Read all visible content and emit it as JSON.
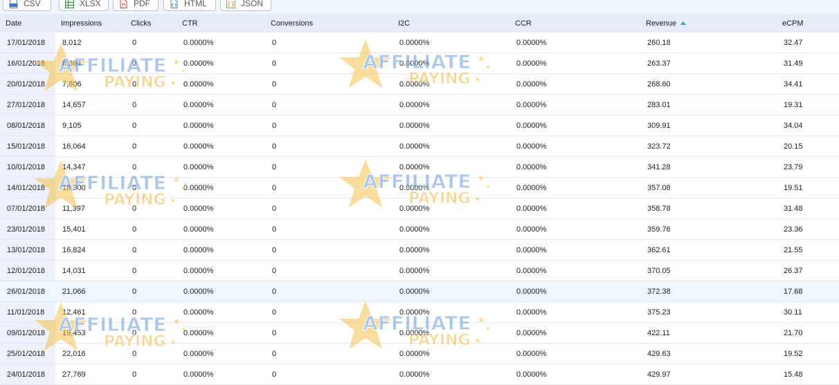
{
  "toolbar": {
    "buttons": [
      {
        "label": "CSV"
      },
      {
        "label": "XLSX"
      },
      {
        "label": "PDF"
      },
      {
        "label": "HTML"
      },
      {
        "label": "JSON"
      }
    ]
  },
  "table": {
    "headers": [
      "Date",
      "Impressions",
      "Clicks",
      "CTR",
      "Conversions",
      "I2C",
      "CCR",
      "Revenue",
      "eCPM"
    ],
    "sort": {
      "column": "Revenue",
      "direction": "ascending"
    },
    "rows": [
      [
        "17/01/2018",
        "8,012",
        "0",
        "0.0000%",
        "0",
        "0.0000%",
        "0.0000%",
        "260.18",
        "32.47"
      ],
      [
        "16/01/2018",
        "8,364",
        "0",
        "0.0000%",
        "0",
        "0.0000%",
        "0.0000%",
        "263.37",
        "31.49"
      ],
      [
        "20/01/2018",
        "7,806",
        "0",
        "0.0000%",
        "0",
        "0.0000%",
        "0.0000%",
        "268.60",
        "34.41"
      ],
      [
        "27/01/2018",
        "14,657",
        "0",
        "0.0000%",
        "0",
        "0.0000%",
        "0.0000%",
        "283.01",
        "19.31"
      ],
      [
        "08/01/2018",
        "9,105",
        "0",
        "0.0000%",
        "0",
        "0.0000%",
        "0.0000%",
        "309.91",
        "34.04"
      ],
      [
        "15/01/2018",
        "16,064",
        "0",
        "0.0000%",
        "0",
        "0.0000%",
        "0.0000%",
        "323.72",
        "20.15"
      ],
      [
        "10/01/2018",
        "14,347",
        "0",
        "0.0000%",
        "0",
        "0.0000%",
        "0.0000%",
        "341.28",
        "23.79"
      ],
      [
        "14/01/2018",
        "18,300",
        "0",
        "0.0000%",
        "0",
        "0.0000%",
        "0.0000%",
        "357.08",
        "19.51"
      ],
      [
        "07/01/2018",
        "11,397",
        "0",
        "0.0000%",
        "0",
        "0.0000%",
        "0.0000%",
        "358.78",
        "31.48"
      ],
      [
        "23/01/2018",
        "15,401",
        "0",
        "0.0000%",
        "0",
        "0.0000%",
        "0.0000%",
        "359.76",
        "23.36"
      ],
      [
        "13/01/2018",
        "16,824",
        "0",
        "0.0000%",
        "0",
        "0.0000%",
        "0.0000%",
        "362.61",
        "21.55"
      ],
      [
        "12/01/2018",
        "14,031",
        "0",
        "0.0000%",
        "0",
        "0.0000%",
        "0.0000%",
        "370.05",
        "26.37"
      ],
      [
        "26/01/2018",
        "21,066",
        "0",
        "0.0000%",
        "0",
        "0.0000%",
        "0.0000%",
        "372.38",
        "17.68"
      ],
      [
        "11/01/2018",
        "12,461",
        "0",
        "0.0000%",
        "0",
        "0.0000%",
        "0.0000%",
        "375.23",
        "30.11"
      ],
      [
        "09/01/2018",
        "19,453",
        "0",
        "0.0000%",
        "0",
        "0.0000%",
        "0.0000%",
        "422.11",
        "21.70"
      ],
      [
        "25/01/2018",
        "22,016",
        "0",
        "0.0000%",
        "0",
        "0.0000%",
        "0.0000%",
        "429.63",
        "19.52"
      ],
      [
        "24/01/2018",
        "27,769",
        "0",
        "0.0000%",
        "0",
        "0.0000%",
        "0.0000%",
        "429.97",
        "15.48"
      ]
    ]
  },
  "watermark": {
    "line1": "AFFILIATE",
    "line2": "PAYING",
    "colors": {
      "star": "#f5c24c",
      "text1": "#6b9ad6",
      "text2": "#f2b63c"
    }
  },
  "colors": {
    "header_bg": "#e7ebf8",
    "toolbar_bg": "#eef5fc",
    "sort_arrow": "#2aa3c6",
    "highlight_row": "#eef7fd"
  },
  "icons": {
    "csv": "csv-file-icon",
    "xlsx": "spreadsheet-icon",
    "pdf": "pdf-file-icon",
    "html": "code-file-icon",
    "json": "json-braces-icon"
  }
}
